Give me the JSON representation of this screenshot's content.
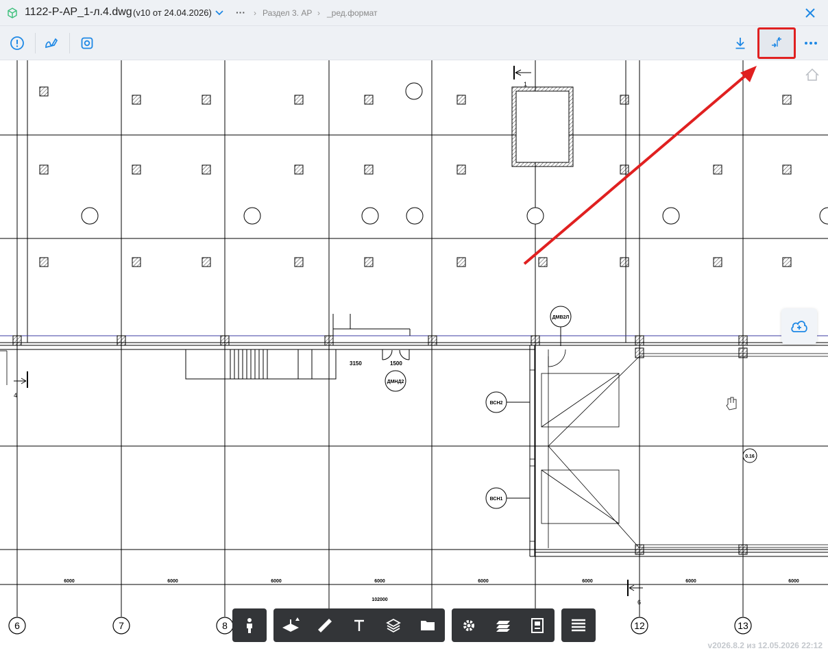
{
  "titlebar": {
    "filename": "1122-Р-АР_1-л.4.dwg",
    "version": "(v10 от 24.04.2026)",
    "more": "···",
    "crumb1": "Раздел 3. АР",
    "crumb2": "_ред.формат"
  },
  "toolbar": {
    "icons": [
      "warning-icon",
      "markup-icon",
      "snapshot-icon",
      "download-icon",
      "compare-icon",
      "more-icon"
    ]
  },
  "drawing": {
    "axis_labels": [
      "6",
      "7",
      "8",
      "12",
      "13"
    ],
    "dim_segments": [
      "6000",
      "6000",
      "6000",
      "6000",
      "6000",
      "6000",
      "6000",
      "6000"
    ],
    "dim_total": "102000",
    "section_marks": [
      "1",
      "4",
      "6"
    ],
    "tags": [
      "ДМВ2Л",
      "ДМНД2",
      "ВСН2",
      "ВСН1",
      "0.16"
    ],
    "stair_dims": [
      "3150",
      "1500"
    ]
  },
  "dock": {
    "tools": [
      "person-icon",
      "axis-icon",
      "ruler-icon",
      "text-icon",
      "layers-icon",
      "folder-icon",
      "settings-icon",
      "sheets-icon",
      "properties-icon",
      "list-icon"
    ]
  },
  "colors": {
    "accent": "#1e88e5",
    "dock_bg": "#333538",
    "highlight": "#e02020"
  },
  "version_text": "v2026.8.2 из 12.05.2026 22:12"
}
